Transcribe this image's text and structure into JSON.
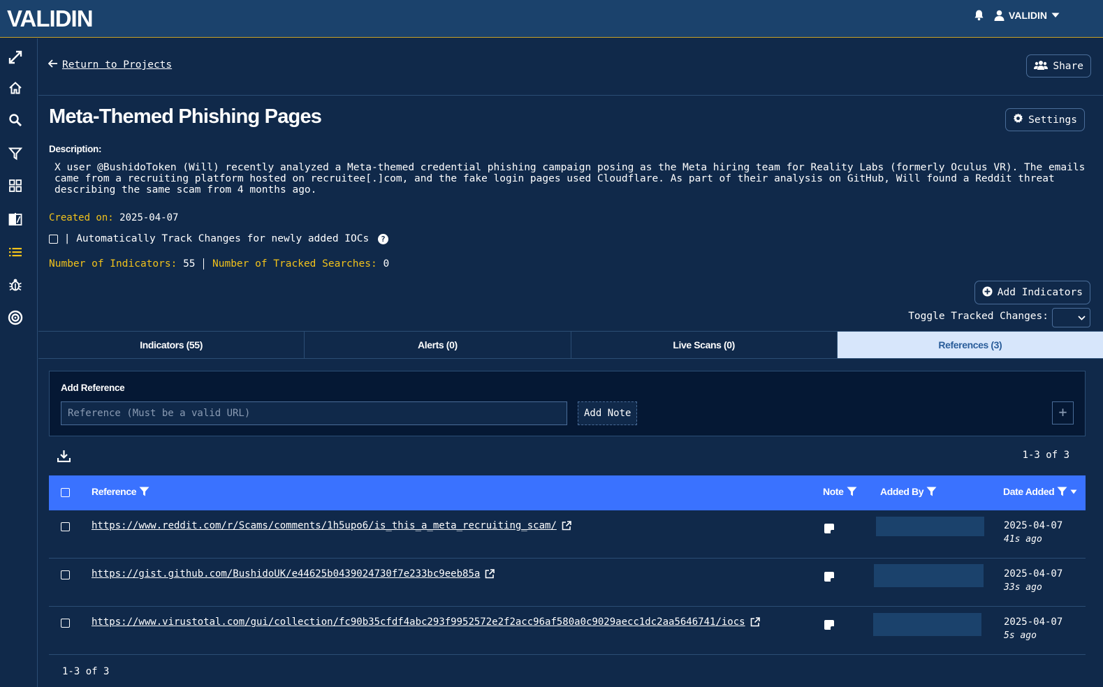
{
  "app": {
    "logo_text": "VALIDIN",
    "user": "VALIDIN"
  },
  "nav": {
    "return_label": " Return to Projects",
    "share_label": "Share",
    "settings_label": "Settings",
    "add_indicators_label": "Add Indicators"
  },
  "project": {
    "title": "Meta-Themed Phishing Pages",
    "description_label": "Description:",
    "description": "X user @BushidoToken (Will) recently analyzed a Meta-themed credential phishing campaign posing as the Meta hiring team for Reality Labs (formerly Oculus VR). The emails came from a recruiting platform hosted on recruitee[.]com, and the fake login pages used Cloudflare. As part of their analysis on GitHub, Will found a Reddit threat describing the same scam from 4 months ago.",
    "created_label": "Created on:",
    "created_value": "2025-04-07",
    "auto_track_label": "| Automatically Track Changes for newly added IOCs",
    "indicators_label": "Number of Indicators:",
    "indicators_value": "55",
    "tracked_label": "Number of Tracked Searches:",
    "tracked_value": "0",
    "toggle_label": "Toggle Tracked Changes:"
  },
  "tabs": [
    {
      "label": "Indicators (55)",
      "active": false
    },
    {
      "label": "Alerts (0)",
      "active": false
    },
    {
      "label": "Live Scans (0)",
      "active": false
    },
    {
      "label": "References (3)",
      "active": true
    }
  ],
  "add_reference": {
    "title": "Add Reference",
    "placeholder": "Reference (Must be a valid URL)",
    "add_note_label": "Add Note",
    "plus": "+"
  },
  "table": {
    "pager": "1-3 of 3",
    "headers": {
      "reference": "Reference",
      "note": "Note",
      "added_by": "Added By",
      "date_added": "Date Added"
    },
    "rows": [
      {
        "url": "https://www.reddit.com/r/Scams/comments/1h5upo6/is_this_a_meta_recruiting_scam/",
        "date": "2025-04-07",
        "ago": "41s ago"
      },
      {
        "url": "https://gist.github.com/BushidoUK/e44625b0439024730f7e233bc9eeb85a",
        "date": "2025-04-07",
        "ago": "33s ago"
      },
      {
        "url": "https://www.virustotal.com/gui/collection/fc90b35cfdf4abc293f9952572e2f2acc96af580a0c9029aecc1dc2aa5646741/iocs",
        "date": "2025-04-07",
        "ago": "5s ago"
      }
    ]
  },
  "colors": {
    "background": "#10294a",
    "topbar": "#1b426c",
    "accent_gold": "#f2c21b",
    "table_header": "#3a72ff",
    "active_tab": "#d7e6fb"
  }
}
